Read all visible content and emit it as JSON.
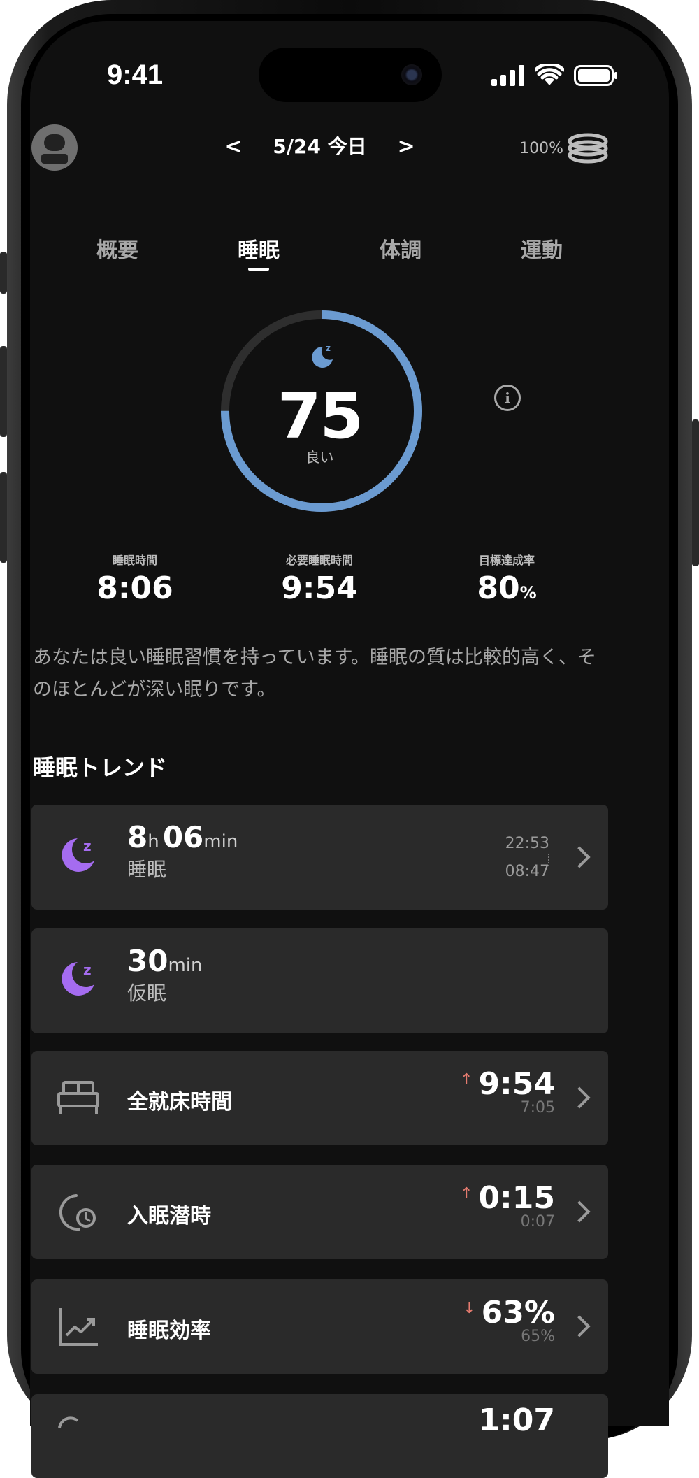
{
  "status_bar": {
    "time": "9:41"
  },
  "header": {
    "date_label": "5/24 今日",
    "battery_percent": "100%"
  },
  "tabs": [
    {
      "label": "概要",
      "active": false
    },
    {
      "label": "睡眠",
      "active": true
    },
    {
      "label": "体調",
      "active": false
    },
    {
      "label": "運動",
      "active": false
    }
  ],
  "score": {
    "value": "75",
    "label": "良い",
    "progress": 0.75,
    "ring_color": "#6b9bd1"
  },
  "stats": [
    {
      "label": "睡眠時間",
      "value": "8:06",
      "unit": ""
    },
    {
      "label": "必要睡眠時間",
      "value": "9:54",
      "unit": ""
    },
    {
      "label": "目標達成率",
      "value": "80",
      "unit": "%"
    }
  ],
  "description": "あなたは良い睡眠習慣を持っています。睡眠の質は比較的高く、そのほとんどが深い眠りです。",
  "section_title": "睡眠トレンド",
  "cards": {
    "sleep": {
      "hours": "8",
      "hours_unit": "h",
      "minutes": "06",
      "minutes_unit": "min",
      "label": "睡眠",
      "start": "22:53",
      "end": "08:47"
    },
    "nap": {
      "minutes": "30",
      "minutes_unit": "min",
      "label": "仮眠"
    },
    "in_bed": {
      "label": "全就床時間",
      "arrow": "↑",
      "value": "9:54",
      "ref": "7:05"
    },
    "latency": {
      "label": "入眠潜時",
      "arrow": "↑",
      "value": "0:15",
      "ref": "0:07"
    },
    "efficiency": {
      "label": "睡眠効率",
      "arrow": "↓",
      "value": "63%",
      "ref": "65%"
    },
    "partial": {
      "value": "1:07"
    }
  },
  "colors": {
    "accent_purple": "#a56cf0",
    "ring_blue": "#6b9bd1",
    "arrow_red": "#e57b6f"
  }
}
